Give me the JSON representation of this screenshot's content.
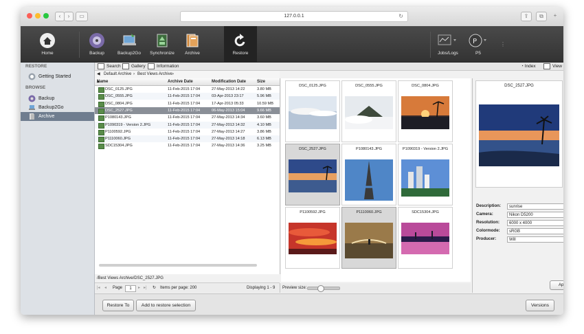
{
  "browser": {
    "url": "127.0.0.1",
    "reload_icon": "reload-icon"
  },
  "toolbar": {
    "home": "Home",
    "backup": "Backup",
    "backup2go": "Backup2Go",
    "synchronize": "Synchronize",
    "archive": "Archive",
    "restore": "Restore",
    "jobs_logs": "Jobs/Logs",
    "p5": "P5"
  },
  "sidebar": {
    "restore_header": "RESTORE",
    "getting_started": "Getting Started",
    "browse_header": "BROWSE",
    "items": [
      "Backup",
      "Backup2Go",
      "Archive"
    ]
  },
  "subbar": {
    "search": "Search",
    "gallery": "Gallery",
    "information": "Information",
    "index": "Index",
    "view": "View"
  },
  "breadcrumb": [
    "Default Archive",
    "Best Views Archive"
  ],
  "table": {
    "columns": [
      "Name",
      "Archive Date",
      "Modification Date",
      "Size"
    ],
    "rows": [
      {
        "name": "DSC_0125.JPG",
        "archive": "11-Feb-2015 17:04",
        "mod": "27-May-2013 14:22",
        "size": "3.80 MB"
      },
      {
        "name": "DSC_0555.JPG",
        "archive": "11-Feb-2015 17:04",
        "mod": "03-Apr-2013 23:17",
        "size": "5.96 MB"
      },
      {
        "name": "DSC_0804.JPG",
        "archive": "11-Feb-2015 17:04",
        "mod": "17-Apr-2013 05:33",
        "size": "10.59 MB"
      },
      {
        "name": "DSC_2527.JPG",
        "archive": "11-Feb-2015 17:04",
        "mod": "06-May-2013 15:04",
        "size": "9.66 MB"
      },
      {
        "name": "P1080143.JPG",
        "archive": "11-Feb-2015 17:04",
        "mod": "27-May-2013 14:34",
        "size": "3.60 MB"
      },
      {
        "name": "P1090319 - Version 2.JPG",
        "archive": "11-Feb-2015 17:04",
        "mod": "27-May-2013 14:32",
        "size": "4.10 MB"
      },
      {
        "name": "P1100592.JPG",
        "archive": "11-Feb-2015 17:04",
        "mod": "27-May-2013 14:27",
        "size": "3.86 MB"
      },
      {
        "name": "P1110060.JPG",
        "archive": "11-Feb-2015 17:04",
        "mod": "27-May-2013 14:18",
        "size": "6.13 MB"
      },
      {
        "name": "SDC15304.JPG",
        "archive": "11-Feb-2015 17:04",
        "mod": "27-May-2013 14:36",
        "size": "3.25 MB"
      }
    ]
  },
  "path": "/Best Views Archive/DSC_2527.JPG",
  "pager": {
    "page_label": "Page",
    "page": "1",
    "items_per_page": "Items per page: 200",
    "displaying": "Displaying 1 - 9"
  },
  "gallery": {
    "items": [
      "DSC_0125.JPG",
      "DSC_0555.JPG",
      "DSC_0804.JPG",
      "DSC_2527.JPG",
      "P1080143.JPG",
      "P1090319 - Version 2.JPG",
      "P1100592.JPG",
      "P1110060.JPG",
      "SDC15304.JPG"
    ],
    "preview_size_label": "Preview size:"
  },
  "preview": {
    "title": "DSC_2527.JPG",
    "labels": [
      "Description:",
      "Camera:",
      "Resolution:",
      "Colormode:",
      "Producer:"
    ],
    "values": [
      "sunrise",
      "Nikon D5200",
      "6000 x 4000",
      "sRGB",
      "Will"
    ],
    "apply": "Apply"
  },
  "bottom": {
    "restore_to": "Restore To",
    "add_to_restore": "Add to restore selection",
    "versions": "Versions"
  }
}
